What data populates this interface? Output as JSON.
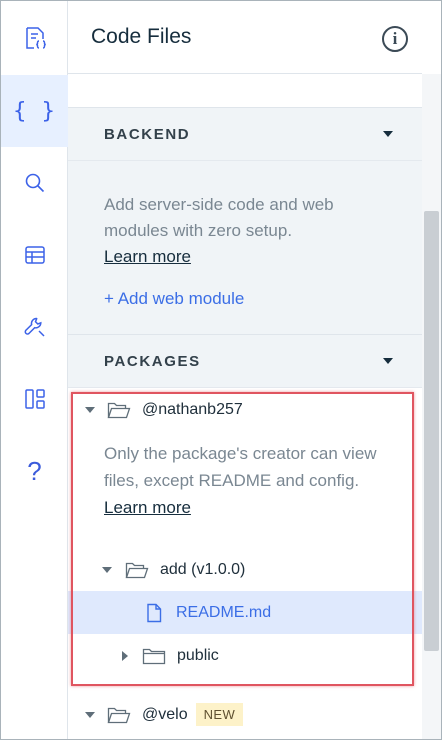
{
  "panel": {
    "title": "Code Files",
    "info_icon": "i"
  },
  "rail": {
    "items": [
      {
        "name": "page-code-icon"
      },
      {
        "name": "code-files-icon",
        "active": true,
        "glyph": "{ }"
      },
      {
        "name": "search-icon"
      },
      {
        "name": "database-icon"
      },
      {
        "name": "wrench-icon"
      },
      {
        "name": "packages-icon"
      },
      {
        "name": "help-icon",
        "glyph": "?"
      }
    ]
  },
  "backend": {
    "label": "BACKEND",
    "description": "Add server-side code and web modules with zero setup.",
    "learn_more": "Learn more",
    "add_link": "+ Add web module"
  },
  "packages": {
    "label": "PACKAGES",
    "owner": "@nathanb257",
    "description": "Only the package's creator can view files, except README and config.",
    "learn_more": "Learn more",
    "package": "add (v1.0.0)",
    "file": "README.md",
    "folder": "public",
    "next_owner": "@velo",
    "next_badge": "NEW"
  },
  "colors": {
    "accent": "#3b6ee6",
    "highlight": "#e05560",
    "section_bg": "#f0f4f7",
    "selected_bg": "#dfe9fd"
  }
}
